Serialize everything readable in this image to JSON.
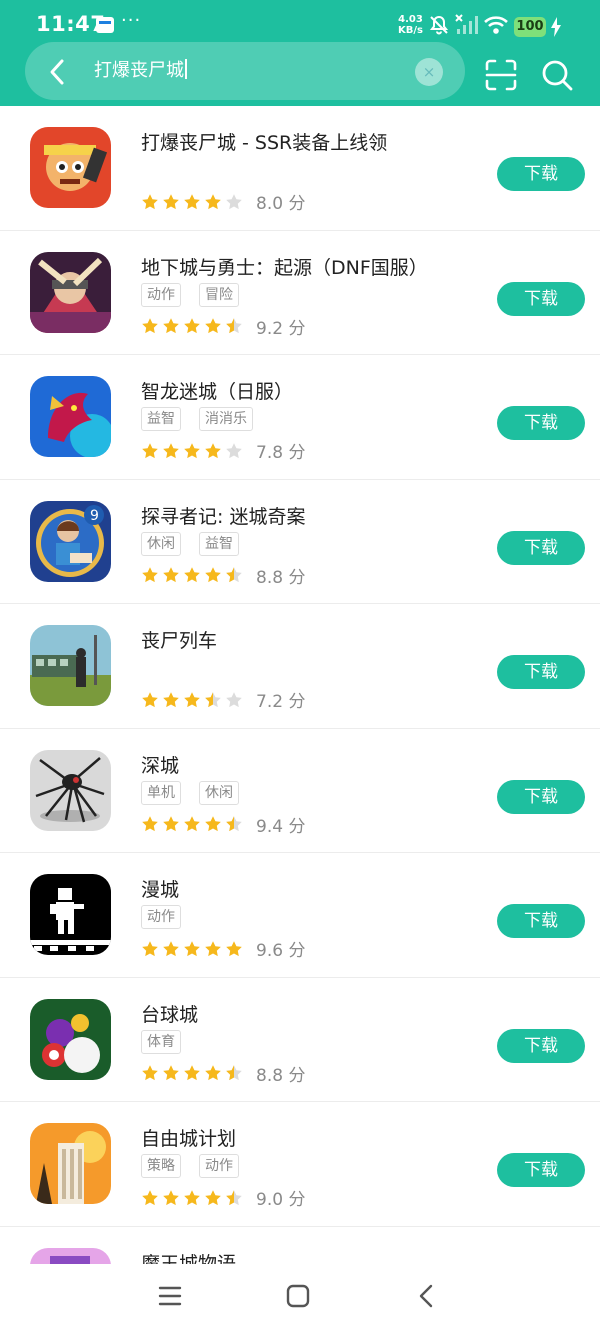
{
  "status_bar": {
    "time": "11:47",
    "dots": "···",
    "net_speed_value": "4.03",
    "net_speed_unit": "KB/s",
    "battery": "100"
  },
  "search": {
    "query": "打爆丧尸城",
    "clear_icon": "×"
  },
  "icons": {
    "back": "chevron-left-icon",
    "scan": "scan-icon",
    "search": "search-icon",
    "clear": "close-icon"
  },
  "colors": {
    "accent": "#1ebf9f",
    "star": "#f6b81c",
    "star_empty": "#dcdcdc"
  },
  "apps": [
    {
      "name": "打爆丧尸城 - SSR装备上线领",
      "tags": [],
      "rating": 4.0,
      "score": "8.0 分",
      "button": "下载"
    },
    {
      "name": "地下城与勇士：起源（DNF国服）",
      "tags": [
        "动作",
        "冒险"
      ],
      "rating": 4.5,
      "score": "9.2 分",
      "button": "下载"
    },
    {
      "name": "智龙迷城（日服）",
      "tags": [
        "益智",
        "消消乐"
      ],
      "rating": 4.0,
      "score": "7.8 分",
      "button": "下载"
    },
    {
      "name": "探寻者记: 迷城奇案",
      "tags": [
        "休闲",
        "益智"
      ],
      "rating": 4.5,
      "score": "8.8 分",
      "button": "下载"
    },
    {
      "name": "丧尸列车",
      "tags": [],
      "rating": 3.5,
      "score": "7.2 分",
      "button": "下载"
    },
    {
      "name": "深城",
      "tags": [
        "单机",
        "休闲"
      ],
      "rating": 4.5,
      "score": "9.4 分",
      "button": "下载"
    },
    {
      "name": "漫城",
      "tags": [
        "动作"
      ],
      "rating": 5.0,
      "score": "9.6 分",
      "button": "下载"
    },
    {
      "name": "台球城",
      "tags": [
        "体育"
      ],
      "rating": 4.5,
      "score": "8.8 分",
      "button": "下载"
    },
    {
      "name": "自由城计划",
      "tags": [
        "策略",
        "动作"
      ],
      "rating": 4.5,
      "score": "9.0 分",
      "button": "下载"
    },
    {
      "name": "魔王城物语",
      "tags": [],
      "rating": 0,
      "score": "",
      "button": ""
    }
  ]
}
